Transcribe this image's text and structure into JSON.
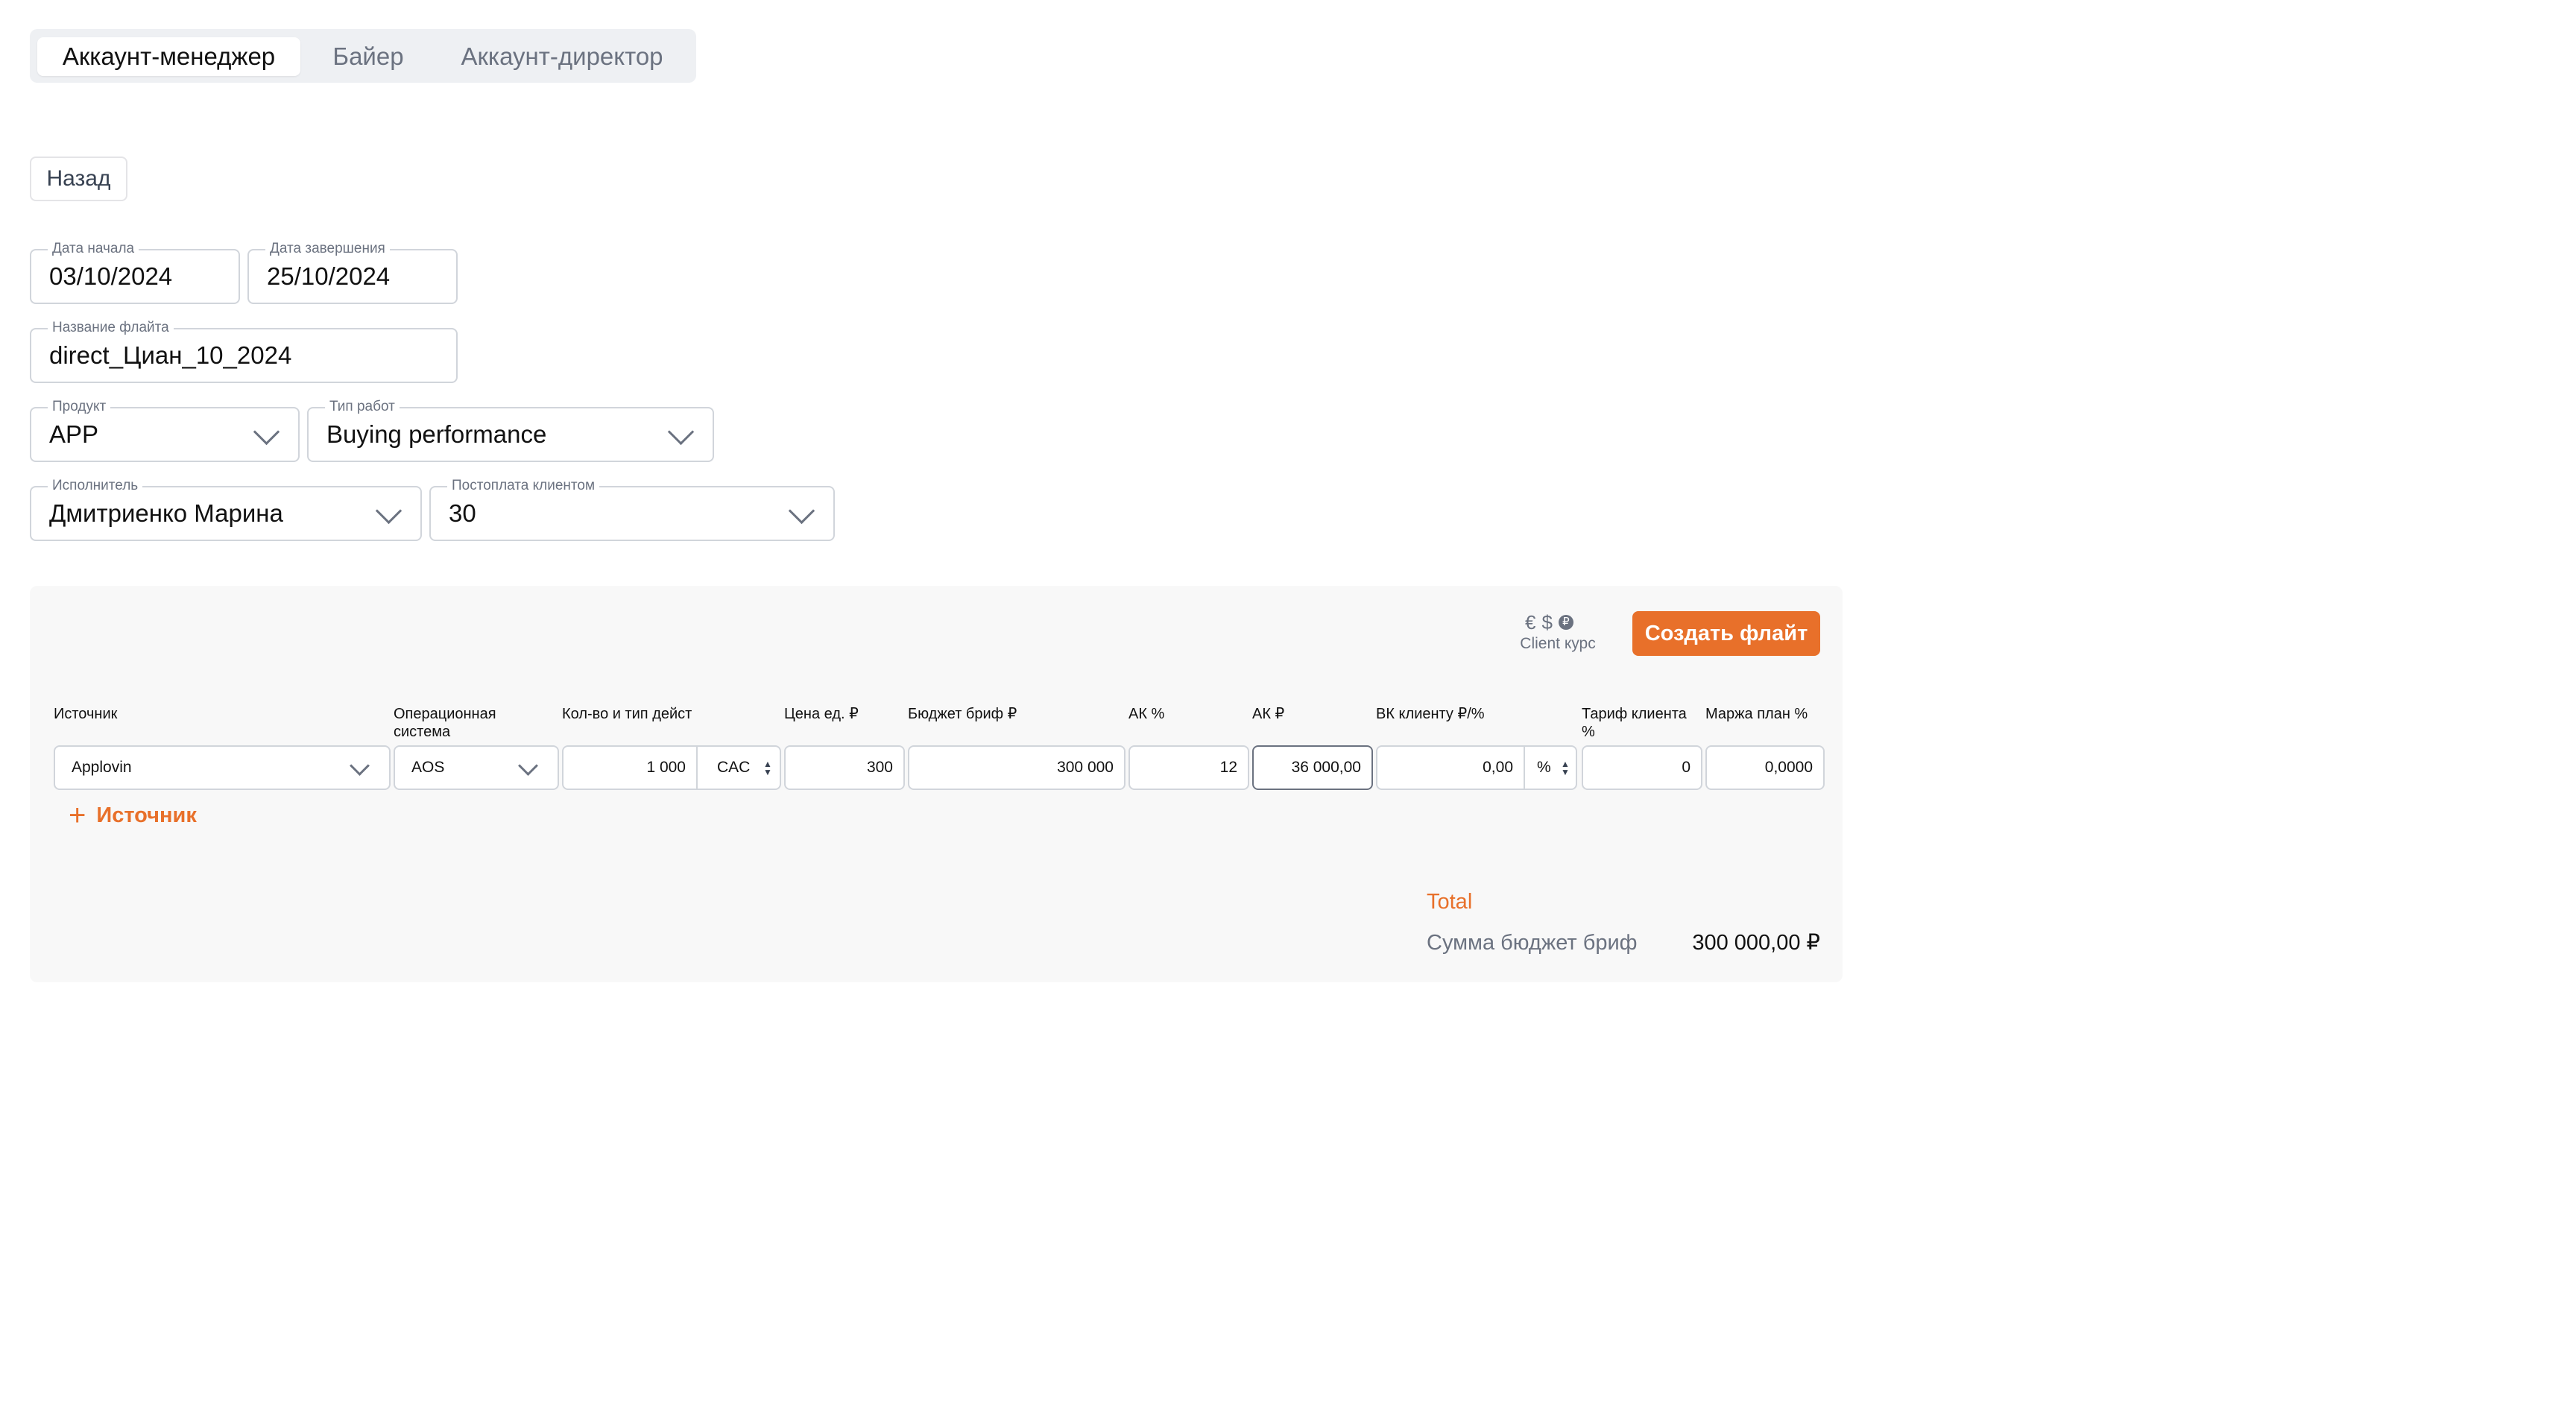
{
  "tabs": [
    {
      "label": "Аккаунт-менеджер",
      "active": true
    },
    {
      "label": "Байер",
      "active": false
    },
    {
      "label": "Аккаунт-директор",
      "active": false
    }
  ],
  "back_button": "Назад",
  "form": {
    "start_date": {
      "label": "Дата начала",
      "value": "03/10/2024"
    },
    "end_date": {
      "label": "Дата завершения",
      "value": "25/10/2024"
    },
    "flight_name": {
      "label": "Название флайта",
      "value": "direct_Циан_10_2024"
    },
    "product": {
      "label": "Продукт",
      "value": "APP"
    },
    "work_type": {
      "label": "Тип работ",
      "value": "Buying performance"
    },
    "executor": {
      "label": "Исполнитель",
      "value": "Дмитриенко Марина"
    },
    "postpay": {
      "label": "Постоплата клиентом",
      "value": "30"
    }
  },
  "panel": {
    "currency_symbols": {
      "euro": "€",
      "dollar": "$",
      "other": "₽"
    },
    "client_rate_label": "Client курс",
    "create_button": "Создать флайт",
    "columns": {
      "source": "Источник",
      "os": "Операционная система",
      "qty_type": "Кол-во и тип дейст",
      "unit_price": "Цена ед. ₽",
      "budget": "Бюджет бриф ₽",
      "ak_pct": "АК %",
      "ak_rub": "АК ₽",
      "bk_client": "ВК клиенту ₽/%",
      "client_tariff": "Тариф клиента %",
      "margin_plan": "Маржа план %"
    },
    "row": {
      "source": "Applovin",
      "os": "AOS",
      "qty": "1 000",
      "action_type": "CAC",
      "unit_price": "300",
      "budget": "300 000",
      "ak_pct": "12",
      "ak_rub": "36 000,00",
      "bk_client": "0,00",
      "bk_unit": "%",
      "client_tariff": "0",
      "margin_plan": "0,0000"
    },
    "add_source": "Источник",
    "total_label": "Total",
    "sum_label": "Сумма бюджет бриф",
    "sum_value": "300 000,00 ₽"
  }
}
